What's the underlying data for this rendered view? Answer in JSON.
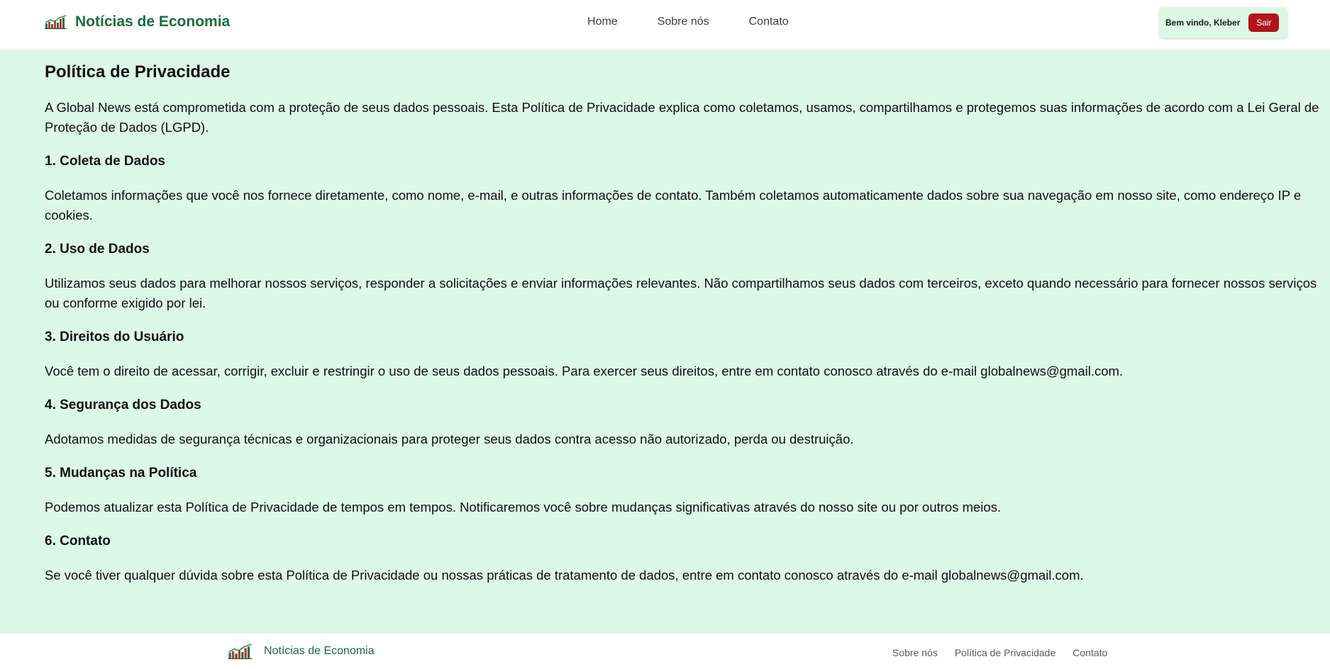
{
  "header": {
    "brand": "Notícias de Economia",
    "nav": [
      "Home",
      "Sobre nós",
      "Contato"
    ],
    "welcome": "Bem vindo, Kleber",
    "logout": "Sair"
  },
  "content": {
    "title": "Política de Privacidade",
    "intro": "A Global News está comprometida com a proteção de seus dados pessoais. Esta Política de Privacidade explica como coletamos, usamos, compartilhamos e protegemos suas informações de acordo com a Lei Geral de Proteção de Dados (LGPD).",
    "sections": [
      {
        "heading": "1. Coleta de Dados",
        "text": "Coletamos informações que você nos fornece diretamente, como nome, e-mail, e outras informações de contato. Também coletamos automaticamente dados sobre sua navegação em nosso site, como endereço IP e cookies."
      },
      {
        "heading": "2. Uso de Dados",
        "text": "Utilizamos seus dados para melhorar nossos serviços, responder a solicitações e enviar informações relevantes. Não compartilhamos seus dados com terceiros, exceto quando necessário para fornecer nossos serviços ou conforme exigido por lei."
      },
      {
        "heading": "3. Direitos do Usuário",
        "text": "Você tem o direito de acessar, corrigir, excluir e restringir o uso de seus dados pessoais. Para exercer seus direitos, entre em contato conosco através do e-mail globalnews@gmail.com."
      },
      {
        "heading": "4. Segurança dos Dados",
        "text": "Adotamos medidas de segurança técnicas e organizacionais para proteger seus dados contra acesso não autorizado, perda ou destruição."
      },
      {
        "heading": "5. Mudanças na Política",
        "text": "Podemos atualizar esta Política de Privacidade de tempos em tempos. Notificaremos você sobre mudanças significativas através do nosso site ou por outros meios."
      },
      {
        "heading": "6. Contato",
        "text": "Se você tiver qualquer dúvida sobre esta Política de Privacidade ou nossas práticas de tratamento de dados, entre em contato conosco através do e-mail globalnews@gmail.com."
      }
    ]
  },
  "footer": {
    "brand": "Notícias de Economia",
    "links": [
      "Sobre nós",
      "Política de Privacidade",
      "Contato"
    ]
  },
  "icons": {
    "logo": "bar-chart-logo-icon"
  },
  "colors": {
    "brand": "#1b6b3c",
    "content_background": "#dcf8e7",
    "logout_button": "#b3121b"
  }
}
